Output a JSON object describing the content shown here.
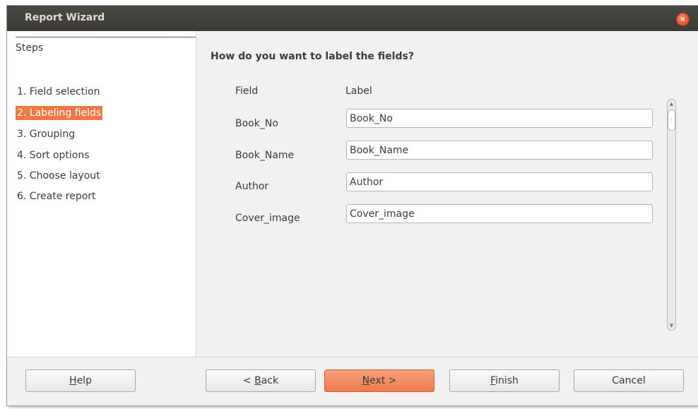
{
  "window": {
    "title": "Report Wizard",
    "close_glyph": "×"
  },
  "sidebar": {
    "heading": "Steps",
    "items": [
      {
        "label": "1. Field selection",
        "active": false
      },
      {
        "label": "2. Labeling fields",
        "active": true
      },
      {
        "label": "3. Grouping",
        "active": false
      },
      {
        "label": "4. Sort options",
        "active": false
      },
      {
        "label": "5. Choose layout",
        "active": false
      },
      {
        "label": "6. Create report",
        "active": false
      }
    ]
  },
  "main": {
    "question": "How do you want to label the fields?",
    "columns": {
      "field": "Field",
      "label": "Label"
    },
    "rows": [
      {
        "field": "Book_No",
        "label": "Book_No"
      },
      {
        "field": "Book_Name",
        "label": "Book_Name"
      },
      {
        "field": "Author",
        "label": "Author"
      },
      {
        "field": "Cover_image",
        "label": "Cover_image"
      }
    ]
  },
  "buttons": {
    "help": {
      "mnemonic": "H",
      "rest": "elp"
    },
    "back": {
      "prefix": "< ",
      "mnemonic": "B",
      "rest": "ack"
    },
    "next": {
      "mnemonic": "N",
      "rest": "ext >"
    },
    "finish": {
      "mnemonic": "F",
      "rest": "inish"
    },
    "cancel": {
      "label": "Cancel"
    }
  },
  "colors": {
    "accent": "#f07746",
    "titlebar": "#3c3b37"
  }
}
